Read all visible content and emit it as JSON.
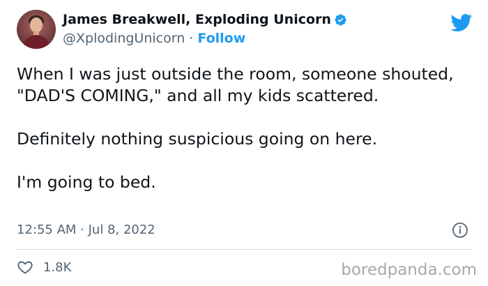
{
  "header": {
    "display_name": "James Breakwell, Exploding Unicorn",
    "handle": "@XplodingUnicorn",
    "separator": " · ",
    "follow_label": "Follow",
    "verified": true
  },
  "tweet": {
    "text": "When I was just outside the room, someone shouted, \"DAD'S COMING,\" and all my kids scattered.\n\nDefinitely nothing suspicious going on here.\n\nI'm going to bed."
  },
  "meta": {
    "timestamp": "12:55 AM · Jul 8, 2022"
  },
  "actions": {
    "like_count": "1.8K"
  },
  "watermark": {
    "text": "boredpanda.com"
  },
  "icons": {
    "verified": "verified-badge-icon",
    "twitter": "twitter-bird-icon",
    "info": "info-icon",
    "like": "heart-icon"
  },
  "colors": {
    "accent": "#1d9bf0",
    "text": "#0f1419",
    "muted": "#536471",
    "divider": "#cfd9de",
    "watermark": "#a8a8a8"
  }
}
